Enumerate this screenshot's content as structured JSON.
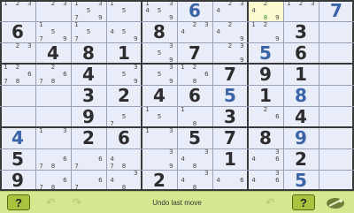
{
  "puzzle": {
    "cells": [
      {
        "r": 0,
        "c": 0,
        "cands": [
          "1",
          "2",
          "3"
        ]
      },
      {
        "r": 0,
        "c": 1,
        "cands": [
          "2",
          "3"
        ]
      },
      {
        "r": 0,
        "c": 2,
        "cands": [
          "1",
          "3",
          "5",
          "7",
          "9"
        ]
      },
      {
        "r": 0,
        "c": 3,
        "cands": [
          "1",
          "5"
        ]
      },
      {
        "r": 0,
        "c": 4,
        "cands": [
          "1",
          "3",
          "4",
          "5",
          "9"
        ]
      },
      {
        "r": 0,
        "c": 5,
        "given": "6",
        "style": "blue"
      },
      {
        "r": 0,
        "c": 6,
        "cands": [
          "2",
          "3",
          "4"
        ]
      },
      {
        "r": 0,
        "c": 7,
        "cands": [
          "2",
          "4",
          "8",
          "9"
        ],
        "green": [
          "8"
        ]
      },
      {
        "r": 0,
        "c": 8,
        "cands": [
          "1",
          "2",
          "3"
        ]
      },
      {
        "r": 0,
        "c": 9,
        "given": "7",
        "style": "blue"
      },
      {
        "r": 1,
        "c": 0,
        "given": "6"
      },
      {
        "r": 1,
        "c": 1,
        "cands": [
          "1",
          "5",
          "7",
          "9"
        ]
      },
      {
        "r": 1,
        "c": 2,
        "cands": [
          "1",
          "5",
          "7"
        ]
      },
      {
        "r": 1,
        "c": 3,
        "cands": [
          "4",
          "5",
          "9"
        ]
      },
      {
        "r": 1,
        "c": 4,
        "given": "8"
      },
      {
        "r": 1,
        "c": 5,
        "cands": [
          "2",
          "4",
          "3"
        ]
      },
      {
        "r": 1,
        "c": 6,
        "cands": [
          "2",
          "4",
          "9"
        ]
      },
      {
        "r": 1,
        "c": 7,
        "cands": [
          "1",
          "2",
          "9"
        ]
      },
      {
        "r": 1,
        "c": 8,
        "given": "3"
      },
      {
        "r": 2,
        "c": 0,
        "cands": [
          "2",
          "3"
        ]
      },
      {
        "r": 2,
        "c": 1,
        "given": "4"
      },
      {
        "r": 2,
        "c": 2,
        "given": "8"
      },
      {
        "r": 2,
        "c": 3,
        "given": "1"
      },
      {
        "r": 2,
        "c": 4,
        "cands": [
          "3",
          "5",
          "9"
        ]
      },
      {
        "r": 2,
        "c": 5,
        "given": "7"
      },
      {
        "r": 2,
        "c": 6,
        "cands": [
          "2",
          "3",
          "9"
        ]
      },
      {
        "r": 2,
        "c": 7,
        "given": "5",
        "style": "blue"
      },
      {
        "r": 2,
        "c": 8,
        "given": "6"
      },
      {
        "r": 3,
        "c": 0,
        "cands": [
          "2",
          "6",
          "8",
          "1",
          "7"
        ]
      },
      {
        "r": 3,
        "c": 1,
        "cands": [
          "2",
          "6",
          "7",
          "8"
        ]
      },
      {
        "r": 3,
        "c": 2,
        "given": "4"
      },
      {
        "r": 3,
        "c": 3,
        "cands": [
          "5",
          "3",
          "9"
        ]
      },
      {
        "r": 3,
        "c": 4,
        "cands": [
          "3",
          "5",
          "9"
        ]
      },
      {
        "r": 3,
        "c": 5,
        "cands": [
          "2",
          "6",
          "8",
          "1"
        ]
      },
      {
        "r": 3,
        "c": 6,
        "given": "7"
      },
      {
        "r": 3,
        "c": 7,
        "given": "9"
      },
      {
        "r": 3,
        "c": 8,
        "given": "1"
      },
      {
        "r": 4,
        "c": 2,
        "given": "3"
      },
      {
        "r": 4,
        "c": 3,
        "given": "2"
      },
      {
        "r": 4,
        "c": 4,
        "given": "4"
      },
      {
        "r": 4,
        "c": 5,
        "given": "6"
      },
      {
        "r": 4,
        "c": 6,
        "given": "5",
        "style": "blue"
      },
      {
        "r": 4,
        "c": 7,
        "given": "1"
      },
      {
        "r": 4,
        "c": 8,
        "given": "8",
        "style": "blue"
      },
      {
        "r": 5,
        "c": 2,
        "given": "9"
      },
      {
        "r": 5,
        "c": 3,
        "cands": [
          "5",
          "7"
        ]
      },
      {
        "r": 5,
        "c": 4,
        "cands": [
          "1",
          "5"
        ]
      },
      {
        "r": 5,
        "c": 5,
        "cands": [
          "1",
          "8"
        ]
      },
      {
        "r": 5,
        "c": 6,
        "given": "3"
      },
      {
        "r": 5,
        "c": 7,
        "cands": [
          "2",
          "6"
        ]
      },
      {
        "r": 5,
        "c": 8,
        "given": "4"
      },
      {
        "r": 6,
        "c": 0,
        "given": "4",
        "style": "blue"
      },
      {
        "r": 6,
        "c": 1,
        "cands": [
          "1",
          "3"
        ]
      },
      {
        "r": 6,
        "c": 2,
        "given": "2"
      },
      {
        "r": 6,
        "c": 3,
        "given": "6"
      },
      {
        "r": 6,
        "c": 4,
        "cands": [
          "1",
          "3"
        ]
      },
      {
        "r": 6,
        "c": 5,
        "given": "5"
      },
      {
        "r": 6,
        "c": 6,
        "given": "7"
      },
      {
        "r": 6,
        "c": 7,
        "given": "8"
      },
      {
        "r": 6,
        "c": 8,
        "given": "9",
        "style": "blue"
      },
      {
        "r": 7,
        "c": 0,
        "given": "5"
      },
      {
        "r": 7,
        "c": 1,
        "cands": [
          "7",
          "8",
          "6"
        ]
      },
      {
        "r": 7,
        "c": 2,
        "cands": [
          "7",
          "6"
        ]
      },
      {
        "r": 7,
        "c": 3,
        "cands": [
          "4",
          "7",
          "8"
        ]
      },
      {
        "r": 7,
        "c": 4,
        "cands": [
          "3",
          "9"
        ]
      },
      {
        "r": 7,
        "c": 5,
        "cands": [
          "4",
          "3",
          "8"
        ]
      },
      {
        "r": 7,
        "c": 6,
        "given": "1"
      },
      {
        "r": 7,
        "c": 7,
        "cands": [
          "4",
          "3",
          "6"
        ]
      },
      {
        "r": 7,
        "c": 8,
        "given": "2"
      },
      {
        "r": 8,
        "c": 0,
        "given": "9"
      },
      {
        "r": 8,
        "c": 1,
        "cands": [
          "7",
          "8",
          "6"
        ]
      },
      {
        "r": 8,
        "c": 2,
        "cands": [
          "7",
          "6"
        ]
      },
      {
        "r": 8,
        "c": 3,
        "cands": [
          "4",
          "8",
          "3"
        ]
      },
      {
        "r": 8,
        "c": 4,
        "given": "2"
      },
      {
        "r": 8,
        "c": 5,
        "cands": [
          "4",
          "3",
          "8"
        ]
      },
      {
        "r": 8,
        "c": 6,
        "cands": [
          "4",
          "6"
        ]
      },
      {
        "r": 8,
        "c": 7,
        "cands": [
          "4",
          "3",
          "6"
        ]
      },
      {
        "r": 8,
        "c": 8,
        "given": "5",
        "style": "blue"
      }
    ],
    "selected": {
      "r": 0,
      "c": 7
    }
  },
  "toolbar": {
    "help_left": "?",
    "help_right": "?",
    "undo_glyph": "↶",
    "redo_glyph": "↷",
    "status": "Undo last move"
  },
  "colors": {
    "board": "#e9ecf9",
    "selected": "#fbfbcf",
    "given_blue": "#3a63a8",
    "candidate_green": "#2e9a2e",
    "toolbar": "#d6e88f"
  }
}
